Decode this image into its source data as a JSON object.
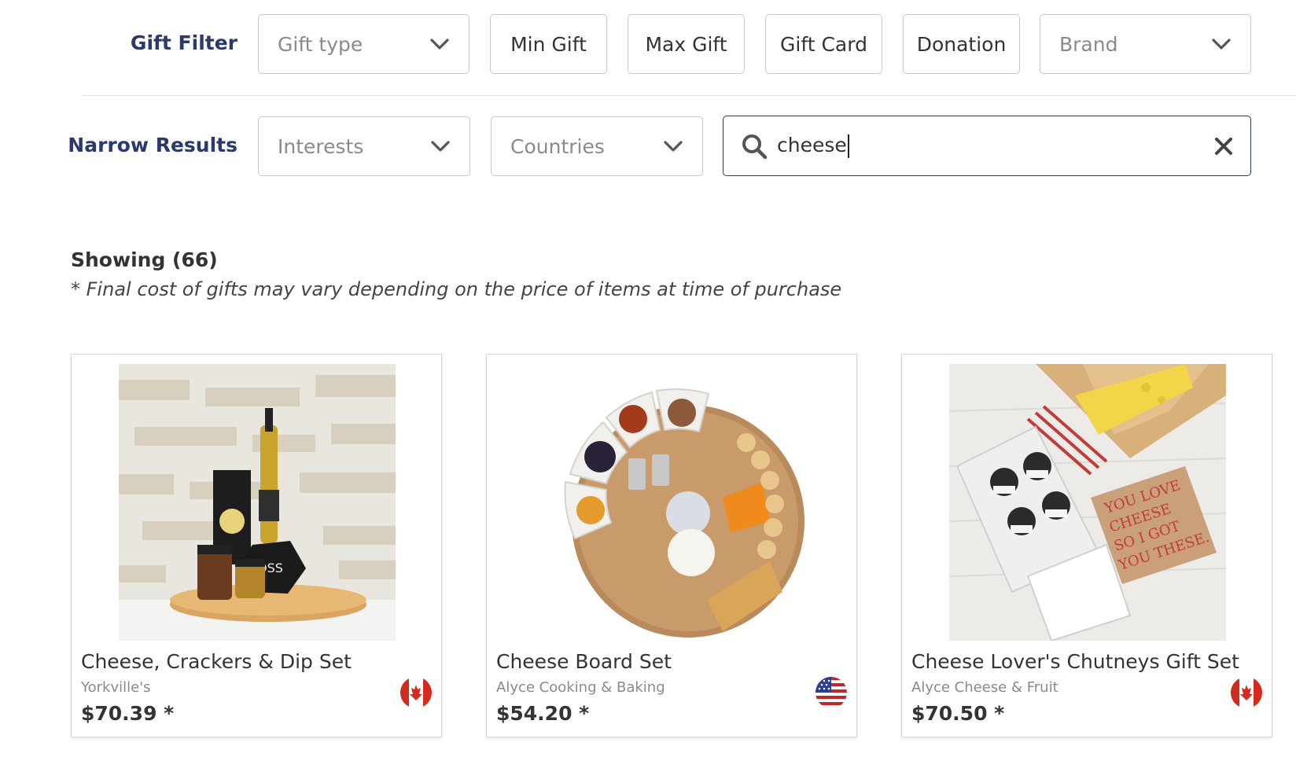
{
  "gift_filter": {
    "label": "Gift Filter",
    "gift_type_placeholder": "Gift type",
    "min_gift": "Min Gift",
    "max_gift": "Max Gift",
    "gift_card": "Gift Card",
    "donation": "Donation",
    "brand_placeholder": "Brand"
  },
  "narrow_results": {
    "label": "Narrow Results",
    "interests_placeholder": "Interests",
    "countries_placeholder": "Countries",
    "search_value": "cheese"
  },
  "results": {
    "showing": "Showing (66)",
    "note": "* Final cost of gifts may vary depending on the price of items at time of purchase"
  },
  "products": [
    {
      "title": "Cheese, Crackers & Dip Set",
      "brand": "Yorkville's",
      "price": "$70.39 *",
      "country_flag": "canada-flag-icon"
    },
    {
      "title": "Cheese Board Set",
      "brand": "Alyce Cooking & Baking",
      "price": "$54.20 *",
      "country_flag": "usa-flag-icon"
    },
    {
      "title": "Cheese Lover's Chutneys Gift Set",
      "brand": "Alyce Cheese & Fruit",
      "price": "$70.50 *",
      "country_flag": "canada-flag-icon"
    }
  ],
  "colors": {
    "label_blue": "#2b3a6b",
    "border": "#c9c9c9",
    "search_border": "#2b3a55"
  }
}
